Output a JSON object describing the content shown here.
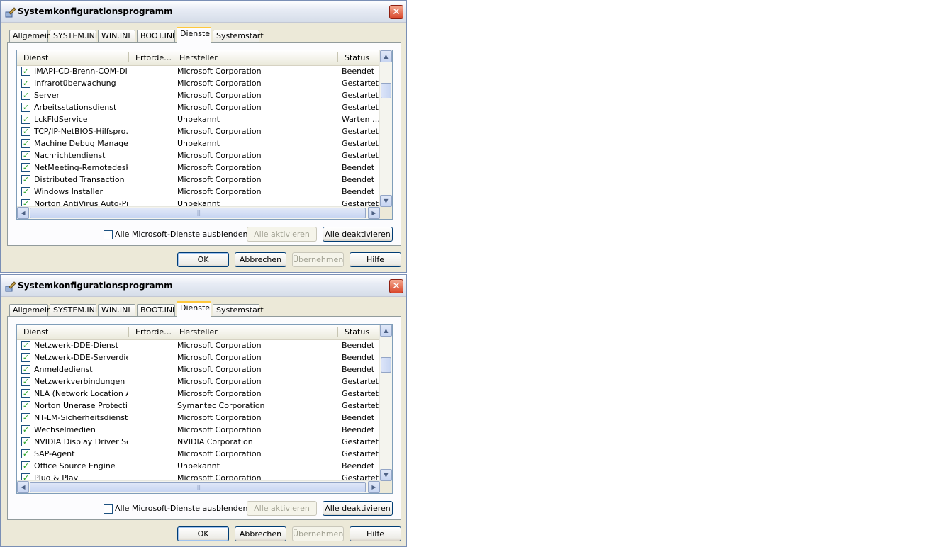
{
  "windows": [
    {
      "title": "Systemkonfigurationsprogramm",
      "tabs": [
        "Allgemein",
        "SYSTEM.INI",
        "WIN.INI",
        "BOOT.INI",
        "Dienste",
        "Systemstart"
      ],
      "active_tab": "Dienste",
      "columns": {
        "dienst": "Dienst",
        "erforderlich": "Erforde…",
        "hersteller": "Hersteller",
        "status": "Status"
      },
      "services": [
        {
          "name": "IMAPI-CD-Brenn-COM-Di…",
          "maker": "Microsoft Corporation",
          "status": "Beendet",
          "checked": true
        },
        {
          "name": "Infrarotüberwachung",
          "maker": "Microsoft Corporation",
          "status": "Gestartet",
          "checked": true
        },
        {
          "name": "Server",
          "maker": "Microsoft Corporation",
          "status": "Gestartet",
          "checked": true
        },
        {
          "name": "Arbeitsstationsdienst",
          "maker": "Microsoft Corporation",
          "status": "Gestartet",
          "checked": true
        },
        {
          "name": "LckFldService",
          "maker": "Unbekannt",
          "status": "Warten …",
          "checked": true
        },
        {
          "name": "TCP/IP-NetBIOS-Hilfspro…",
          "maker": "Microsoft Corporation",
          "status": "Gestartet",
          "checked": true
        },
        {
          "name": "Machine Debug Manager",
          "maker": "Unbekannt",
          "status": "Gestartet",
          "checked": true
        },
        {
          "name": "Nachrichtendienst",
          "maker": "Microsoft Corporation",
          "status": "Gestartet",
          "checked": true
        },
        {
          "name": "NetMeeting-Remotedesk…",
          "maker": "Microsoft Corporation",
          "status": "Beendet",
          "checked": true
        },
        {
          "name": "Distributed Transaction …",
          "maker": "Microsoft Corporation",
          "status": "Beendet",
          "checked": true
        },
        {
          "name": "Windows Installer",
          "maker": "Microsoft Corporation",
          "status": "Beendet",
          "checked": true
        },
        {
          "name": "Norton AntiVirus Auto-Pr…",
          "maker": "Unbekannt",
          "status": "Gestartet",
          "checked": true
        }
      ],
      "hide_ms_label": "Alle Microsoft-Dienste ausblenden",
      "hide_ms_checked": false,
      "enable_all": "Alle aktivieren",
      "disable_all": "Alle deaktivieren",
      "ok": "OK",
      "cancel": "Abbrechen",
      "apply": "Übernehmen",
      "help": "Hilfe"
    },
    {
      "title": "Systemkonfigurationsprogramm",
      "tabs": [
        "Allgemein",
        "SYSTEM.INI",
        "WIN.INI",
        "BOOT.INI",
        "Dienste",
        "Systemstart"
      ],
      "active_tab": "Dienste",
      "columns": {
        "dienst": "Dienst",
        "erforderlich": "Erforde…",
        "hersteller": "Hersteller",
        "status": "Status"
      },
      "services": [
        {
          "name": "Netzwerk-DDE-Dienst",
          "maker": "Microsoft Corporation",
          "status": "Beendet",
          "checked": true
        },
        {
          "name": "Netzwerk-DDE-Serverdie…",
          "maker": "Microsoft Corporation",
          "status": "Beendet",
          "checked": true
        },
        {
          "name": "Anmeldedienst",
          "maker": "Microsoft Corporation",
          "status": "Beendet",
          "checked": true
        },
        {
          "name": "Netzwerkverbindungen",
          "maker": "Microsoft Corporation",
          "status": "Gestartet",
          "checked": true
        },
        {
          "name": "NLA (Network Location A…",
          "maker": "Microsoft Corporation",
          "status": "Gestartet",
          "checked": true
        },
        {
          "name": "Norton Unerase Protection",
          "maker": "Symantec Corporation",
          "status": "Gestartet",
          "checked": true
        },
        {
          "name": "NT-LM-Sicherheitsdienst",
          "maker": "Microsoft Corporation",
          "status": "Beendet",
          "checked": true
        },
        {
          "name": "Wechselmedien",
          "maker": "Microsoft Corporation",
          "status": "Beendet",
          "checked": true
        },
        {
          "name": "NVIDIA Display Driver Se…",
          "maker": "NVIDIA Corporation",
          "status": "Gestartet",
          "checked": true
        },
        {
          "name": "SAP-Agent",
          "maker": "Microsoft Corporation",
          "status": "Gestartet",
          "checked": true
        },
        {
          "name": "Office Source Engine",
          "maker": "Unbekannt",
          "status": "Beendet",
          "checked": true
        },
        {
          "name": "Plug & Play",
          "maker": "Microsoft Corporation",
          "status": "Gestartet",
          "checked": true
        }
      ],
      "hide_ms_label": "Alle Microsoft-Dienste ausblenden",
      "hide_ms_checked": false,
      "enable_all": "Alle aktivieren",
      "disable_all": "Alle deaktivieren",
      "ok": "OK",
      "cancel": "Abbrechen",
      "apply": "Übernehmen",
      "help": "Hilfe"
    }
  ],
  "icons": {
    "app": "msconfig-icon",
    "close": "close-icon",
    "check": "checkmark-icon"
  },
  "colors": {
    "accent": "#ffc83c",
    "close": "#d9472b",
    "check": "#21a121"
  }
}
